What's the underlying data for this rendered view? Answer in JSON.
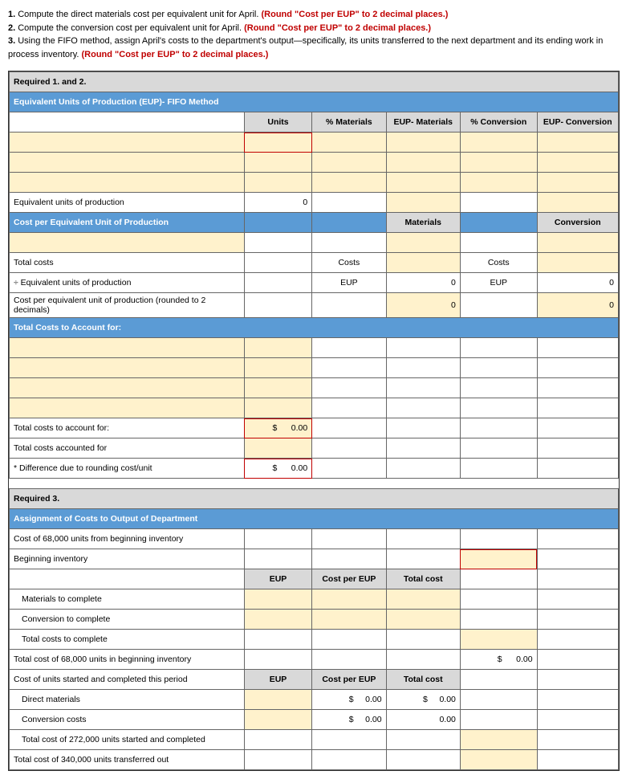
{
  "instructions": {
    "line1_prefix": "1. ",
    "line1_text": "Compute the direct materials cost per equivalent unit for April. ",
    "line1_red": "(Round \"Cost per EUP\" to 2 decimal places.)",
    "line2_prefix": "2. ",
    "line2_text": "Compute the conversion cost per equivalent unit for April. ",
    "line2_red": "(Round \"Cost per EUP\" to 2 decimal places.)",
    "line3_prefix": "3. ",
    "line3_text": "Using the FIFO method, assign April's costs to the department's output—specifically, its units transferred to the next department and its ending work in process inventory. ",
    "line3_red": "(Round \"Cost per EUP\" to 2 decimal places.)"
  },
  "section1": {
    "req_header": "Required 1. and 2.",
    "eup_header": "Equivalent Units of Production (EUP)- FIFO Method",
    "cols": {
      "units": "Units",
      "pct_mat": "% Materials",
      "eup_mat": "EUP- Materials",
      "pct_conv": "% Conversion",
      "eup_conv": "EUP- Conversion"
    },
    "row_eup": "Equivalent units of production",
    "val_eup_units": "0",
    "cost_per_eup_header": "Cost per Equivalent Unit of Production",
    "col_mat": "Materials",
    "col_conv": "Conversion",
    "row_total_costs": "Total costs",
    "row_div_eup": "÷ Equivalent units of production",
    "row_cost_per_eup": "Cost per equivalent unit of production (rounded to 2 decimals)",
    "lbl_costs": "Costs",
    "lbl_eup": "EUP",
    "val_zero": "0",
    "total_costs_acc_header": "Total Costs to Account for:",
    "row_tca": "Total costs to account for:",
    "row_tcaf": "Total costs accounted for",
    "row_diff": "* Difference due to rounding cost/unit",
    "val_tca": "0.00",
    "val_diff": "0.00",
    "currency": "$"
  },
  "section3": {
    "req_header": "Required 3.",
    "assign_header": "Assignment of Costs to Output of Department",
    "row_68k": "Cost of 68,000 units from beginning inventory",
    "row_begin": "Beginning inventory",
    "col_eup": "EUP",
    "col_cpe": "Cost per EUP",
    "col_total": "Total cost",
    "row_mat_complete": "Materials to complete",
    "row_conv_complete": "Conversion to complete",
    "row_total_complete": "Total costs to complete",
    "row_total_68k": "Total cost of 68,000 units in beginning inventory",
    "row_started": "Cost of units started and completed this period",
    "row_dm": "Direct materials",
    "row_cc": "Conversion costs",
    "row_total_272k": "Total cost of 272,000 units started and completed",
    "row_total_340k": "Total cost of 340,000 units transferred out",
    "val_zero2": "0.00",
    "currency": "$"
  }
}
